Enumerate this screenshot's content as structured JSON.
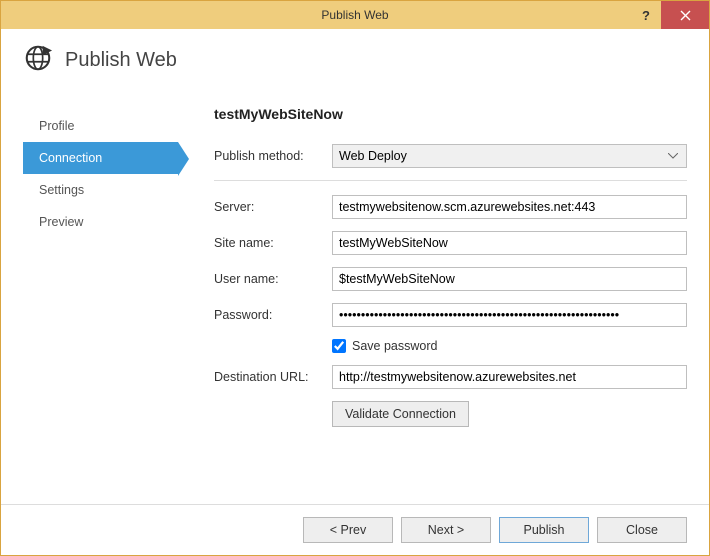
{
  "window": {
    "title": "Publish Web"
  },
  "header": {
    "title": "Publish Web"
  },
  "sidebar": {
    "items": [
      {
        "label": "Profile",
        "active": false
      },
      {
        "label": "Connection",
        "active": true
      },
      {
        "label": "Settings",
        "active": false
      },
      {
        "label": "Preview",
        "active": false
      }
    ]
  },
  "main": {
    "profile_name": "testMyWebSiteNow",
    "publish_method": {
      "label": "Publish method:",
      "value": "Web Deploy"
    },
    "server": {
      "label": "Server:",
      "value": "testmywebsitenow.scm.azurewebsites.net:443"
    },
    "site_name": {
      "label": "Site name:",
      "value": "testMyWebSiteNow"
    },
    "user_name": {
      "label": "User name:",
      "value": "$testMyWebSiteNow"
    },
    "password": {
      "label": "Password:",
      "value": "●●●●●●●●●●●●●●●●●●●●●●●●●●●●●●●●●●●●●●●●●●●●●●●●●●●●●●●●●●●●●●●●"
    },
    "save_password": {
      "label": "Save password",
      "checked": true
    },
    "destination_url": {
      "label": "Destination URL:",
      "value": "http://testmywebsitenow.azurewebsites.net"
    },
    "validate_button": "Validate Connection"
  },
  "footer": {
    "prev": "< Prev",
    "next": "Next >",
    "publish": "Publish",
    "close": "Close"
  }
}
